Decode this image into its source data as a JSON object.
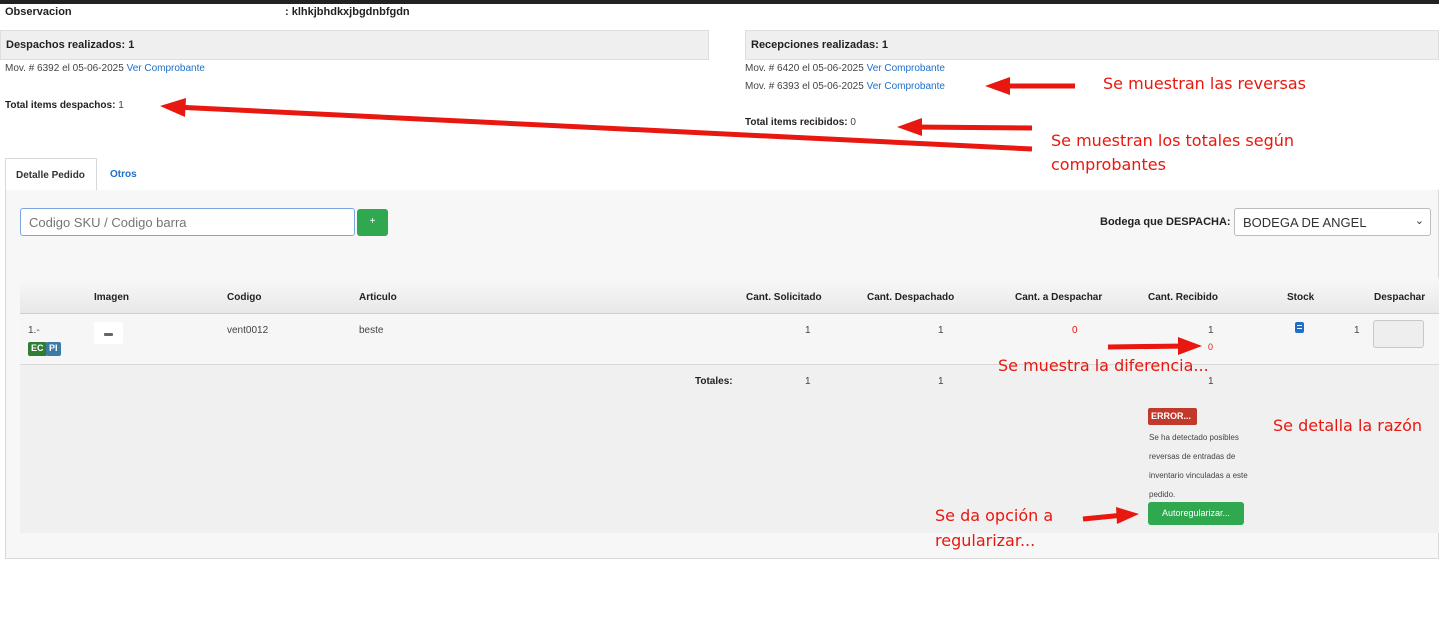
{
  "header": {
    "observacion_label": "Observacion",
    "observacion_value": ": klhkjbhdkxjbgdnbfgdn"
  },
  "despachos": {
    "title": "Despachos realizados: 1",
    "mov_text": "Mov. # 6392 el 05-06-2025",
    "mov_link": "Ver Comprobante",
    "total_label": "Total items despachos:",
    "total_value": "1"
  },
  "recepciones": {
    "title": "Recepciones realizadas: 1",
    "movs": [
      {
        "text": "Mov. # 6420 el 05-06-2025",
        "link": "Ver Comprobante"
      },
      {
        "text": "Mov. # 6393 el 05-06-2025",
        "link": "Ver Comprobante"
      }
    ],
    "total_label": "Total items recibidos:",
    "total_value": "0"
  },
  "tabs": [
    {
      "label": "Detalle Pedido",
      "active": true
    },
    {
      "label": "Otros",
      "active": false
    }
  ],
  "search": {
    "placeholder": "Codigo SKU / Codigo barra",
    "add_label": "+"
  },
  "bodega": {
    "label": "Bodega que DESPACHA:",
    "selected": "BODEGA DE ANGEL"
  },
  "table": {
    "headers": {
      "imagen": "Imagen",
      "codigo": "Codigo",
      "articulo": "Articulo",
      "solicitado": "Cant. Solicitado",
      "despachado": "Cant. Despachado",
      "a_despachar": "Cant. a Despachar",
      "recibido": "Cant. Recibido",
      "stock": "Stock",
      "despachar": "Despachar"
    },
    "row": {
      "index": "1.-",
      "badge_ec": "EC",
      "badge_pi": "PI",
      "codigo": "vent0012",
      "articulo": "beste",
      "solicitado": "1",
      "despachado": "1",
      "a_despachar": "0",
      "recibido": "1",
      "recibido_diff": "0",
      "stock_value": "1"
    },
    "totales": {
      "label": "Totales:",
      "solicitado": "1",
      "despachado": "1",
      "recibido": "1"
    }
  },
  "error": {
    "badge": "ERROR...",
    "message": "Se ha detectado posibles reversas de entradas de inventario vinculadas a este pedido.",
    "button": "Autoregularizar..."
  },
  "annotations": {
    "reversas": "Se muestran las reversas",
    "totales_line1": "Se muestran los totales según",
    "totales_line2": "comprobantes",
    "diferencia": "Se muestra la diferencia...",
    "razon": "Se detalla la razón",
    "opcion_line1": "Se da opción a",
    "opcion_line2": "regularizar..."
  },
  "colors": {
    "link": "#1e6fc8",
    "green": "#2fa84f",
    "error": "#c0392b",
    "annotation": "#e8170f",
    "badge_ec": "#2e7d32",
    "badge_pi": "#3a7ca5"
  }
}
